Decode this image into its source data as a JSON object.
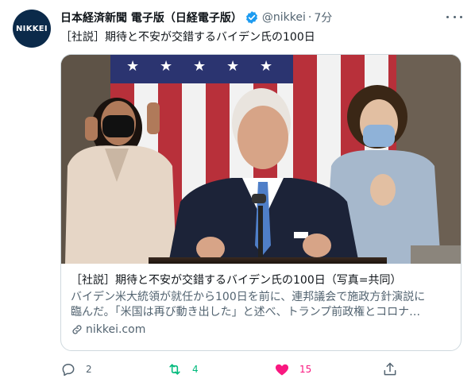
{
  "account": {
    "avatar_text": "NIKKEI",
    "display_name": "日本経済新聞 電子版（日経電子版）",
    "handle": "@nikkei",
    "separator": "·",
    "time": "7分"
  },
  "tweet": {
    "text": "［社説］期待と不安が交錯するバイデン氏の100日"
  },
  "card": {
    "title": "［社説］期待と不安が交錯するバイデン氏の100日（写真=共同）",
    "description_line1": "バイデン米大統領が就任から100日を前に、連邦議会で施政方針演説に",
    "description_line2": "臨んだ。「米国は再び動き出した」と述べ、トランプ前政権とコロナ…",
    "domain": "nikkei.com"
  },
  "actions": {
    "reply_count": "2",
    "retweet_count": "4",
    "like_count": "15"
  },
  "colors": {
    "verified": "#1d9bf0",
    "retweet": "#00ba7c",
    "like": "#f91880",
    "secondary_text": "#536471",
    "avatar_bg": "#0b2a4a"
  },
  "icons": [
    "verified-badge-icon",
    "more-icon",
    "link-icon",
    "reply-icon",
    "retweet-icon",
    "like-icon",
    "share-icon"
  ]
}
